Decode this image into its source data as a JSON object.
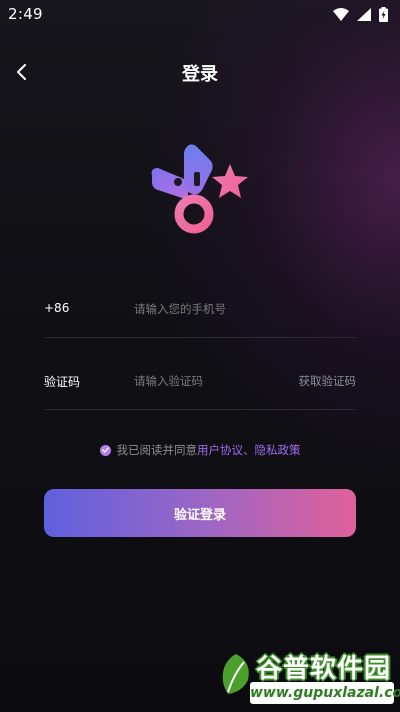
{
  "status_bar": {
    "time": "2:49"
  },
  "header": {
    "title": "登录",
    "back_icon": "chevron-left-icon"
  },
  "form": {
    "phone": {
      "country_code": "+86",
      "placeholder": "请输入您的手机号",
      "value": ""
    },
    "code": {
      "label": "验证码",
      "placeholder": "请输入验证码",
      "value": "",
      "get_code_label": "获取验证码"
    }
  },
  "agreement": {
    "checked": true,
    "prefix": "我已阅读并同意",
    "user_agreement": "用户协议",
    "separator": "、",
    "privacy_policy": "隐私政策"
  },
  "login_button": {
    "label": "验证登录"
  },
  "watermark": {
    "brand": "谷普软件园",
    "url": "www.gupuxlazal.com"
  },
  "colors": {
    "background": "#0c0c10",
    "accent_purple": "#a06cf2",
    "button_gradient_start": "#6060de",
    "button_gradient_end": "#e0619a",
    "divider": "#2a2a31"
  }
}
